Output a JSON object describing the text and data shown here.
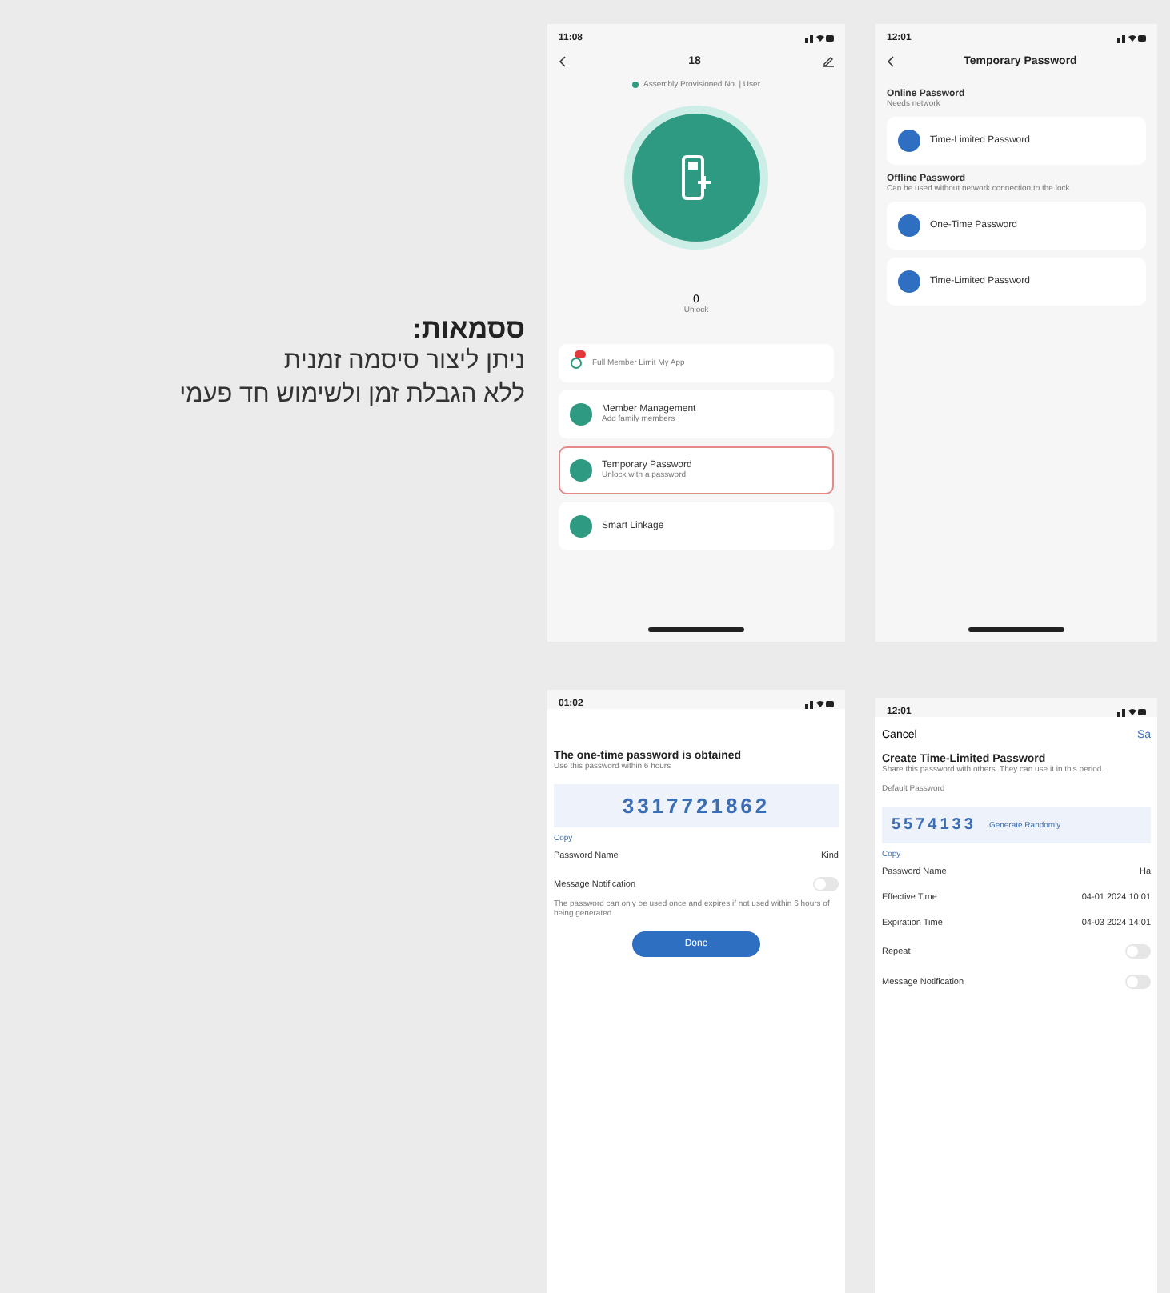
{
  "note": {
    "title": "ססמאות:",
    "lines": [
      "ניתן ליצור סיסמה זמנית",
      "ללא הגבלת זמן ולשימוש חד פעמי"
    ]
  },
  "lock_screen": {
    "time": "11:08",
    "title": "18",
    "status": "Assembly Provisioned No. | User",
    "count": "0",
    "count_label": "Unlock",
    "notice": {
      "text": "Full Member Limit My App",
      "badge": true
    },
    "items": [
      {
        "title": "Member Management",
        "subtitle": "Add family members",
        "selected": false
      },
      {
        "title": "Temporary Password",
        "subtitle": "Unlock with a password",
        "selected": true
      },
      {
        "title": "Smart Linkage",
        "selected": false
      }
    ]
  },
  "password_types": {
    "time": "12:01",
    "title": "Temporary Password",
    "sections": [
      {
        "heading": "Online Password",
        "hint": "Needs network",
        "items": [
          "Time-Limited Password"
        ]
      },
      {
        "heading": "Offline Password",
        "hint": "Can be used without network connection to the lock",
        "items": [
          "One-Time Password",
          "Time-Limited Password"
        ]
      }
    ]
  },
  "one_time": {
    "time": "01:02",
    "title": "The one-time password is obtained",
    "hint": "Use this password within 6 hours",
    "code": "3317721862",
    "copy": "Copy",
    "rows": [
      {
        "label": "Password Name",
        "value": "Kind",
        "kind": "text"
      },
      {
        "label": "Message Notification",
        "on": false,
        "kind": "toggle"
      }
    ],
    "footnote": "The password can only be used once and expires if not used within 6 hours of being generated",
    "button": "Done"
  },
  "time_limited": {
    "time": "12:01",
    "cancel": "Cancel",
    "save": "Sa",
    "title": "Create Time-Limited Password",
    "hint": "Share this password with others. They can use it in this period.",
    "code_label": "Default Password",
    "code": "5574133",
    "regen": "Generate Randomly",
    "copy": "Copy",
    "rows": [
      {
        "label": "Password Name",
        "value": "Ha",
        "kind": "text"
      },
      {
        "label": "Effective Time",
        "value": "04-01 2024 10:01",
        "kind": "text"
      },
      {
        "label": "Expiration Time",
        "value": "04-03 2024 14:01",
        "kind": "text"
      },
      {
        "label": "Repeat",
        "on": false,
        "kind": "toggle"
      },
      {
        "label": "Message Notification",
        "on": false,
        "kind": "toggle"
      }
    ]
  }
}
